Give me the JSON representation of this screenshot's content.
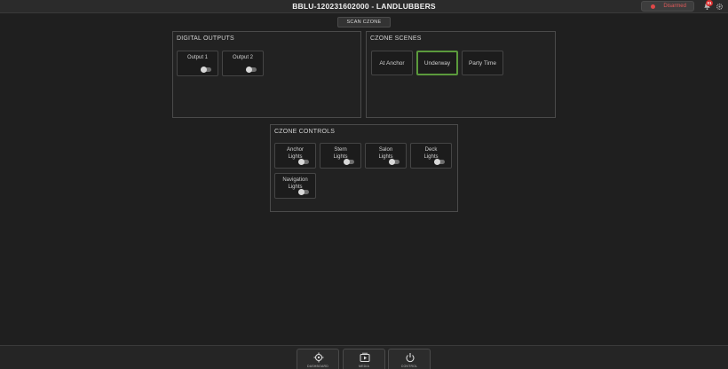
{
  "header": {
    "title": "BBLU-120231602000 - LANDLUBBERS",
    "status_label": "Disarmed",
    "notification_count": "01"
  },
  "scan_button": "SCAN CZONE",
  "digital_outputs": {
    "title": "DIGITAL OUTPUTS",
    "items": [
      {
        "label": "Output 1",
        "state": "off"
      },
      {
        "label": "Output 2",
        "state": "off"
      }
    ]
  },
  "czone_scenes": {
    "title": "CZONE SCENES",
    "items": [
      {
        "label": "At Anchor",
        "active": false
      },
      {
        "label": "Underway",
        "active": true
      },
      {
        "label": "Party Time",
        "active": false
      }
    ]
  },
  "czone_controls": {
    "title": "CZONE CONTROLS",
    "items": [
      {
        "label": "Anchor\nLights",
        "state": "off"
      },
      {
        "label": "Stern\nLights",
        "state": "off"
      },
      {
        "label": "Salon\nLights",
        "state": "off"
      },
      {
        "label": "Deck\nLights",
        "state": "off"
      },
      {
        "label": "Navigation\nLights",
        "state": "off"
      }
    ]
  },
  "bottom_nav": [
    {
      "label": "DASHBOARD",
      "icon": "crosshair-icon"
    },
    {
      "label": "MEDIA",
      "icon": "media-icon"
    },
    {
      "label": "CONTROL",
      "icon": "power-icon"
    }
  ],
  "colors": {
    "background": "#1f1f1f",
    "active_scene_border": "#5b9a3c",
    "status_red": "#e05a5a",
    "badge_red": "#d62a2a"
  }
}
